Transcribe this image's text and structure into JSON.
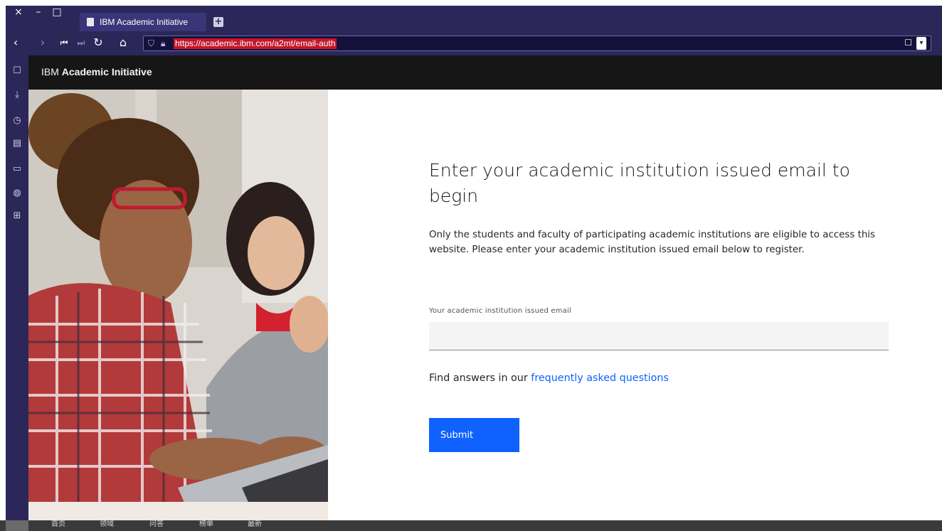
{
  "browser": {
    "window_buttons": [
      "×",
      "–",
      "□"
    ],
    "tab": {
      "title": "IBM Academic Initiative"
    },
    "new_tab_symbol": "+",
    "nav": {
      "back": "‹",
      "forward": "›",
      "first": "⏮",
      "last": "⏭",
      "reload": "↻",
      "home": "⌂"
    },
    "url": "https://academic.ibm.com/a2mt/email-auth",
    "bookmark_symbol": "☐",
    "dropdown_symbol": "▾"
  },
  "sidebar": {
    "icons": [
      "bookmark-icon",
      "download-icon",
      "history-icon",
      "notes-icon",
      "window-icon",
      "globe-icon",
      "add-panel-icon"
    ]
  },
  "header": {
    "brand_prefix": "IBM",
    "brand_name": "Academic Initiative"
  },
  "main": {
    "heading": "Enter your academic institution issued email to begin",
    "description": "Only the students and faculty of participating academic institutions are eligible to access this website. Please enter your academic institution issued email below to register.",
    "email_label": "Your academic institution issued email",
    "email_value": "",
    "faq_prefix": "Find answers in our",
    "faq_link": "frequently asked questions",
    "submit_label": "Submit"
  },
  "bottom_bar": {
    "items": [
      "首页",
      "领域",
      "问答",
      "榜单",
      "最新"
    ]
  },
  "colors": {
    "browser_chrome": "#2b2758",
    "ibm_blue": "#0f62fe",
    "header_bg": "#161616",
    "url_highlight": "#c4162a"
  }
}
